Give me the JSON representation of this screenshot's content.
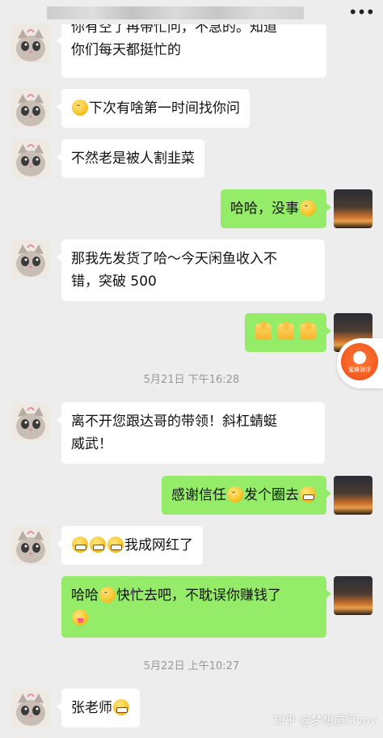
{
  "topbar": {
    "more_icon": "more-dots-icon"
  },
  "messages": {
    "m1": {
      "side": "left",
      "line1": "你有空了再带忙问，不急的。知道",
      "line2": "你们每天都挺忙的"
    },
    "m2": {
      "side": "left",
      "text": "下次有啥第一时间找你问"
    },
    "m3": {
      "side": "left",
      "text": "不然老是被人割韭菜"
    },
    "m4": {
      "side": "right",
      "text": "哈哈，没事"
    },
    "m5": {
      "side": "left",
      "line1": "那我先发货了哈～今天闲鱼收入不",
      "line2": "错，突破 500"
    },
    "m6": {
      "side": "right",
      "text": ""
    },
    "m7": {
      "side": "left",
      "line1": "离不开您跟达哥的带领！斜杠蜻蜓",
      "line2": "威武！"
    },
    "m8": {
      "side": "right",
      "text_a": "感谢信任",
      "text_b": "发个圈去"
    },
    "m9": {
      "side": "left",
      "text": "我成网红了"
    },
    "m10": {
      "side": "right",
      "text_a": "哈哈",
      "text_b": "快忙去吧，不耽误你赚钱了"
    },
    "m11": {
      "side": "left",
      "text": "张老师"
    }
  },
  "timestamps": {
    "t1": "5月21日 下午16:28",
    "t2": "5月22日 上午10:27"
  },
  "float_button": {
    "label": "蜜蜂测评"
  },
  "watermark": "知乎 @梦想前行vov",
  "colors": {
    "bg": "#ededed",
    "bubble_left": "#ffffff",
    "bubble_right": "#95ec69",
    "accent": "#f35a1f"
  }
}
